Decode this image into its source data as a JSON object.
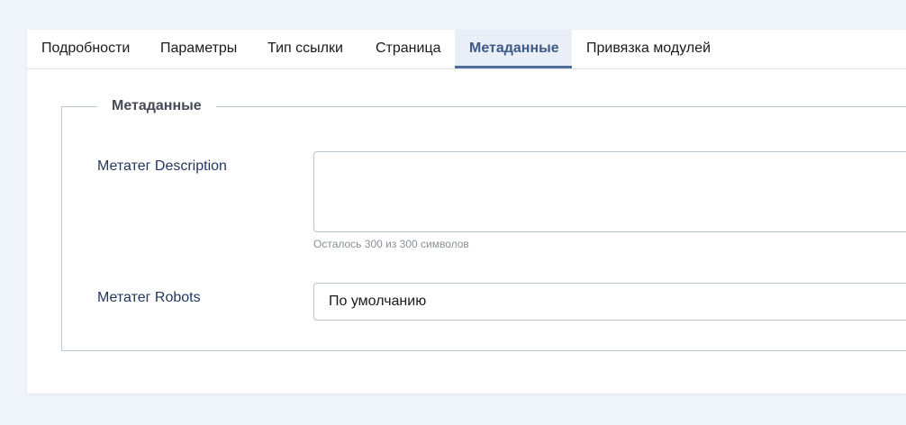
{
  "tabs": [
    {
      "label": "Подробности"
    },
    {
      "label": "Параметры"
    },
    {
      "label": "Тип ссылки"
    },
    {
      "label": "Страница"
    },
    {
      "label": "Метаданные",
      "active": true
    },
    {
      "label": "Привязка модулей"
    }
  ],
  "fieldset": {
    "legend": "Метаданные"
  },
  "fields": {
    "description": {
      "label": "Метатег Description",
      "value": "",
      "counter": "Осталось 300 из 300 символов"
    },
    "robots": {
      "label": "Метатег Robots",
      "selected": "По умолчанию"
    }
  },
  "colors": {
    "accent": "#4f6e9c",
    "active_tab_bg": "#eaeff7",
    "label_text": "#22375e",
    "page_bg": "#f0f4fb"
  }
}
